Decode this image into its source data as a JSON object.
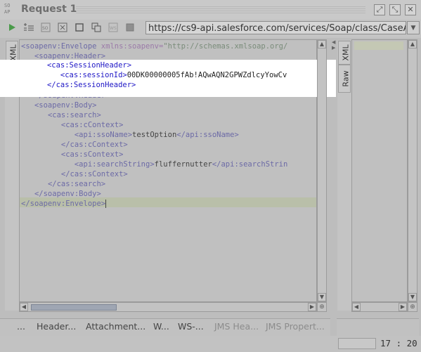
{
  "window": {
    "logo_text": "SO\nAP",
    "title": "Request 1",
    "buttons": {
      "detach": "⤢",
      "maximize": "⤡",
      "close": "✕"
    }
  },
  "toolbar": {
    "url": "https://cs9-api.salesforce.com/services/Soap/class/CaseAPI",
    "icons": [
      "run-icon",
      "add-icon",
      "wsa-icon",
      "settings-icon",
      "stop-icon",
      "clone-icon",
      "ws-icon",
      "square-icon"
    ]
  },
  "side_tabs": {
    "xml": "XML",
    "raw": "Raw"
  },
  "editor": {
    "lines": [
      {
        "indent": "",
        "parts": [
          {
            "c": "tag",
            "t": "<soapenv:Envelope "
          },
          {
            "c": "attr",
            "t": "xmlns:soapenv="
          },
          {
            "c": "val",
            "t": "\"http://schemas.xmlsoap.org/"
          }
        ]
      },
      {
        "indent": "   ",
        "parts": [
          {
            "c": "tag",
            "t": "<soapenv:Header>"
          }
        ]
      },
      {
        "indent": "      ",
        "hl": true,
        "parts": [
          {
            "c": "tag",
            "t": "<cas:SessionHeader>"
          }
        ]
      },
      {
        "indent": "         ",
        "hl": true,
        "parts": [
          {
            "c": "tag",
            "t": "<cas:sessionId>"
          },
          {
            "c": "txt",
            "t": "00DK00000005fAb!AQwAQN2GPWZdlcyYowCv"
          }
        ]
      },
      {
        "indent": "      ",
        "hl": true,
        "parts": [
          {
            "c": "tag",
            "t": "</cas:SessionHeader>"
          }
        ]
      },
      {
        "indent": "   ",
        "parts": [
          {
            "c": "tag",
            "t": "</soapenv:Header>"
          }
        ]
      },
      {
        "indent": "   ",
        "parts": [
          {
            "c": "tag",
            "t": "<soapenv:Body>"
          }
        ]
      },
      {
        "indent": "      ",
        "parts": [
          {
            "c": "tag",
            "t": "<cas:search>"
          }
        ]
      },
      {
        "indent": "         ",
        "parts": [
          {
            "c": "tag",
            "t": "<cas:cContext>"
          }
        ]
      },
      {
        "indent": "            ",
        "parts": [
          {
            "c": "tag",
            "t": "<api:ssoName>"
          },
          {
            "c": "txt",
            "t": "testOption"
          },
          {
            "c": "tag",
            "t": "</api:ssoName>"
          }
        ]
      },
      {
        "indent": "         ",
        "parts": [
          {
            "c": "tag",
            "t": "</cas:cContext>"
          }
        ]
      },
      {
        "indent": "         ",
        "parts": [
          {
            "c": "tag",
            "t": "<cas:sContext>"
          }
        ]
      },
      {
        "indent": "            ",
        "parts": [
          {
            "c": "tag",
            "t": "<api:searchString>"
          },
          {
            "c": "txt",
            "t": "fluffernutter"
          },
          {
            "c": "tag",
            "t": "</api:searchStrin"
          }
        ]
      },
      {
        "indent": "         ",
        "parts": [
          {
            "c": "tag",
            "t": "</cas:sContext>"
          }
        ]
      },
      {
        "indent": "      ",
        "parts": [
          {
            "c": "tag",
            "t": "</cas:search>"
          }
        ]
      },
      {
        "indent": "   ",
        "parts": [
          {
            "c": "tag",
            "t": "</soapenv:Body>"
          }
        ]
      },
      {
        "indent": "",
        "parts": [
          {
            "c": "tag",
            "t": "</soapenv:Envelope>"
          }
        ]
      }
    ]
  },
  "bottom_tabs": [
    {
      "label": "...",
      "enabled": true
    },
    {
      "label": "Header...",
      "enabled": true
    },
    {
      "label": "Attachment...",
      "enabled": true
    },
    {
      "label": "W...",
      "enabled": true
    },
    {
      "label": "WS-...",
      "enabled": true
    },
    {
      "label": "JMS Hea...",
      "enabled": false
    },
    {
      "label": "JMS Propert...",
      "enabled": false
    }
  ],
  "status": {
    "cursor_position": "17 : 20"
  }
}
